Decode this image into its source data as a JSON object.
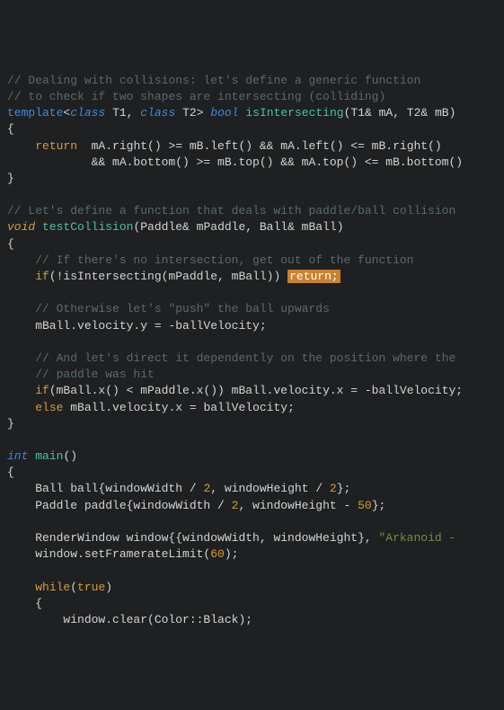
{
  "code": {
    "l1": "// Dealing with collisions: let's define a generic function",
    "l2": "// to check if two shapes are intersecting (colliding)",
    "l3_template": "template",
    "l3_class": "class",
    "l3_t1": "T1",
    "l3_t2": "T2",
    "l3_bool": "bool",
    "l3_fn": "isIntersecting",
    "l3_p1": "(T1& mA, T2& mB)",
    "l4": "{",
    "l5_return": "return",
    "l5_body": "  mA.right() >= mB.left() && mA.left() <= mB.right()",
    "l6_body": "            && mA.bottom() >= mB.top() && mA.top() <= mB.bottom()",
    "l7": "}",
    "l9": "// Let's define a function that deals with paddle/ball collision",
    "l10_void": "void",
    "l10_fn": "testCollision",
    "l10_params": "(Paddle& mPaddle, Ball& mBall)",
    "l11": "{",
    "l12": "    // If there's no intersection, get out of the function",
    "l13_if": "if",
    "l13_cond": "(!isIntersecting(mPaddle, mBall)) ",
    "l13_return": "return;",
    "l15": "    // Otherwise let's \"push\" the ball upwards",
    "l16": "    mBall.velocity.y = -ballVelocity;",
    "l18": "    // And let's direct it dependently on the position where the",
    "l19": "    // paddle was hit",
    "l20_if": "if",
    "l20_cond": "(mBall.x() < mPaddle.x()) mBall.velocity.x = -ballVelocity;",
    "l21_else": "else",
    "l21_body": " mBall.velocity.x = ballVelocity;",
    "l22": "}",
    "l24_int": "int",
    "l24_main": "main",
    "l24_p": "()",
    "l25": "{",
    "l26_a": "    Ball ball{windowWidth / ",
    "l26_n1": "2",
    "l26_b": ", windowHeight / ",
    "l26_n2": "2",
    "l26_c": "};",
    "l27_a": "    Paddle paddle{windowWidth / ",
    "l27_n1": "2",
    "l27_b": ", windowHeight - ",
    "l27_n2": "50",
    "l27_c": "};",
    "l29_a": "    RenderWindow window{{windowWidth, windowHeight}, ",
    "l29_s": "\"Arkanoid - ",
    "l30_a": "    window.setFramerateLimit(",
    "l30_n": "60",
    "l30_b": ");",
    "l32_while": "while",
    "l32_cond_a": "(",
    "l32_true": "true",
    "l32_cond_b": ")",
    "l33": "    {",
    "l34": "        window.clear(Color::Black);"
  }
}
